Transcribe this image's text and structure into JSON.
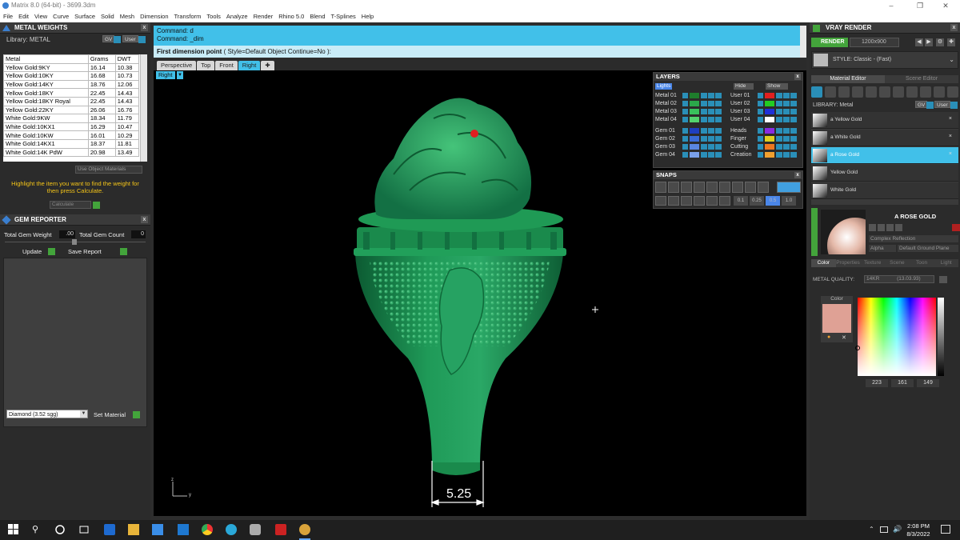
{
  "window": {
    "title": "Matrix 8.0 (64-bit) - 3699.3dm"
  },
  "menu": [
    "File",
    "Edit",
    "View",
    "Curve",
    "Surface",
    "Solid",
    "Mesh",
    "Dimension",
    "Transform",
    "Tools",
    "Analyze",
    "Render",
    "Rhino 5.0",
    "Blend",
    "T-Splines",
    "Help"
  ],
  "metal_weights": {
    "title": "METAL WEIGHTS",
    "library_label": "Library: METAL",
    "lib_btn1": "GV",
    "lib_btn2": "User",
    "columns": [
      "Metal",
      "Grams",
      "DWT"
    ],
    "rows": [
      [
        "Yellow Gold:9KY",
        "16.14",
        "10.38"
      ],
      [
        "Yellow Gold:10KY",
        "16.68",
        "10.73"
      ],
      [
        "Yellow Gold:14KY",
        "18.76",
        "12.06"
      ],
      [
        "Yellow Gold:18KY",
        "22.45",
        "14.43"
      ],
      [
        "Yellow Gold:18KY Royal",
        "22.45",
        "14.43"
      ],
      [
        "Yellow Gold:22KY",
        "26.06",
        "16.76"
      ],
      [
        "White Gold:9KW",
        "18.34",
        "11.79"
      ],
      [
        "White Gold:10KX1",
        "16.29",
        "10.47"
      ],
      [
        "White Gold:10KW",
        "16.01",
        "10.29"
      ],
      [
        "White Gold:14KX1",
        "18.37",
        "11.81"
      ],
      [
        "White Gold:14K PdW",
        "20.98",
        "13.49"
      ]
    ],
    "use_object_materials": "Use Object Materials",
    "hint": "Highlight the item you want to find the weight for then press Calculate.",
    "calculate": "Calculate"
  },
  "gem_reporter": {
    "title": "GEM REPORTER",
    "total_weight_label": "Total Gem Weight",
    "total_weight_value": ".00",
    "total_count_label": "Total Gem Count",
    "total_count_value": "0",
    "update": "Update",
    "save_report": "Save Report",
    "material_select": "Diamond    (3.52 sgg)",
    "set_material": "Set Material"
  },
  "command": {
    "line1": "Command: d",
    "line2": "Command: _dim",
    "prompt_main": "First dimension point",
    "prompt_opts": "( Style=Default  Object  Continue=No ):"
  },
  "view_tabs": [
    "Perspective",
    "Top",
    "Front",
    "Right"
  ],
  "active_view_label": "Right",
  "dimension_value": "5.25",
  "axis": {
    "z": "z",
    "y": "y"
  },
  "layers": {
    "title": "LAYERS",
    "lights": "Lights",
    "hide": "Hide",
    "show": "Show",
    "left": [
      {
        "name": "Metal 01",
        "color": "#1e7d2c"
      },
      {
        "name": "Metal 02",
        "color": "#2ba84a"
      },
      {
        "name": "Metal 03",
        "color": "#39c25c"
      },
      {
        "name": "Metal 04",
        "color": "#54d46e"
      },
      {
        "name": "Gem 01",
        "color": "#1f3fbf"
      },
      {
        "name": "Gem 02",
        "color": "#3a6bd6"
      },
      {
        "name": "Gem 03",
        "color": "#5a86e0"
      },
      {
        "name": "Gem 04",
        "color": "#7aa0ea"
      }
    ],
    "right": [
      {
        "name": "User 01",
        "color": "#e02020"
      },
      {
        "name": "User 02",
        "color": "#22cc22"
      },
      {
        "name": "User 03",
        "color": "#2030d8"
      },
      {
        "name": "User 04",
        "color": "#ffffff"
      },
      {
        "name": "Heads",
        "color": "#8a2be2"
      },
      {
        "name": "Finger",
        "color": "#e0d020"
      },
      {
        "name": "Cutting",
        "color": "#f07820"
      },
      {
        "name": "Creation",
        "color": "#f0a030"
      }
    ]
  },
  "snaps": {
    "title": "SNAPS",
    "vals": [
      "0.1",
      "0.25",
      "0.5",
      "1.0"
    ]
  },
  "vray": {
    "title": "VRAY RENDER",
    "render": "RENDER",
    "resolution": "1200x900",
    "style": "STYLE: Classic - (Fast)",
    "tabs": [
      "Material Editor",
      "Scene Editor"
    ],
    "library": "LIBRARY: Metal",
    "lib_btn1": "GV",
    "lib_btn2": "User",
    "materials": [
      "a Yellow Gold",
      "a White Gold",
      "a Rose Gold",
      "Yellow Gold",
      "White Gold"
    ],
    "selected_material": "a Rose Gold",
    "preview_title": "A ROSE GOLD",
    "reflection": "Complex Reflection",
    "alpha": "Alpha",
    "ground": "Default Ground Plane",
    "sub_tabs": [
      "Color",
      "Properties",
      "Texture",
      "Scene",
      "Toon",
      "Light"
    ],
    "metal_quality_label": "METAL QUALITY:",
    "metal_quality_value": "14KR",
    "metal_quality_extra": "(13.03.93)",
    "color_label": "Color",
    "swatch_color": "#dfa195",
    "rgb": [
      "223",
      "161",
      "149"
    ]
  },
  "taskbar": {
    "time": "2:08 PM",
    "date": "8/3/2022"
  }
}
